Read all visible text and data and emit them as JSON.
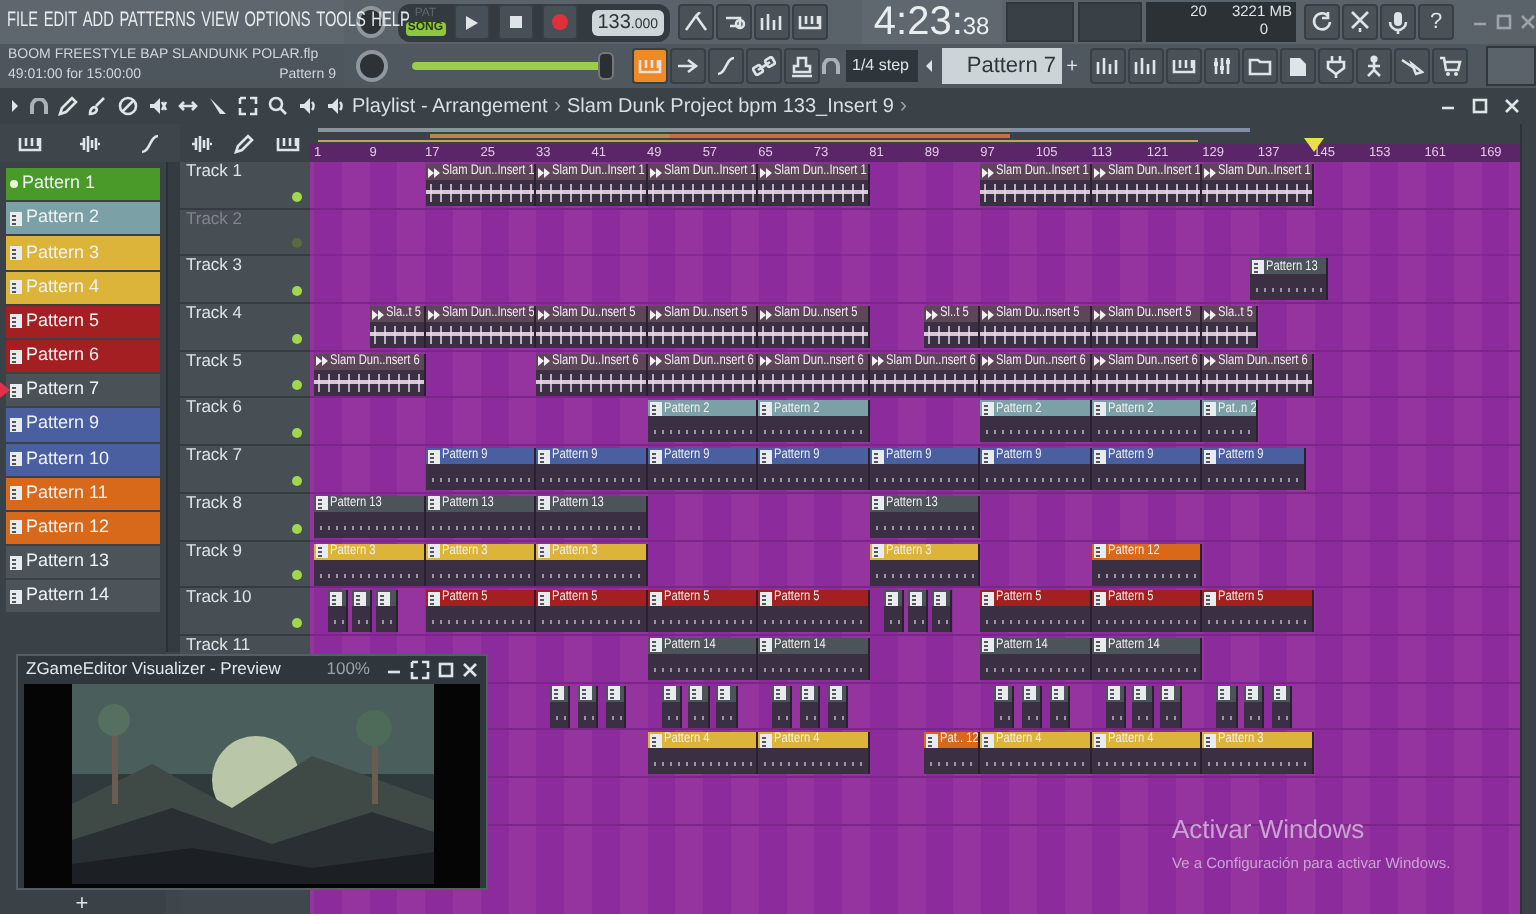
{
  "menu": [
    "FILE",
    "EDIT",
    "ADD",
    "PATTERNS",
    "VIEW",
    "OPTIONS",
    "TOOLS",
    "HELP"
  ],
  "mode_toggle": [
    {
      "label": "PAT",
      "selected": false
    },
    {
      "label": "SONG",
      "selected": true
    }
  ],
  "tempo": {
    "whole": "133",
    "fraction": ".000"
  },
  "time": {
    "main": "4:23:",
    "small": "38"
  },
  "cpu": {
    "value": "20",
    "memory": "3221 MB",
    "polyphony": "0"
  },
  "help_button": "?",
  "info": {
    "file": "BOOM FREESTYLE BAP SLANDUNK POLAR.flp",
    "position": "49:01:00 for 15:00:00",
    "pattern": "Pattern 9"
  },
  "pitch_slider": {
    "level": 0.97
  },
  "keyboard_toggle": {
    "on": true
  },
  "snap": "1/4 step",
  "pattern_selector": {
    "value": "Pattern 7",
    "add": "+"
  },
  "breadcrumb": [
    {
      "kind": "crumb",
      "text": "Playlist - Arrangement"
    },
    {
      "kind": "sep",
      "text": "›"
    },
    {
      "kind": "crumb",
      "text": "Slam Dunk Project bpm 133_Insert 9"
    },
    {
      "kind": "sep",
      "text": "›"
    }
  ],
  "ruler": [
    "1",
    "9",
    "17",
    "25",
    "33",
    "41",
    "49",
    "57",
    "65",
    "73",
    "81",
    "89",
    "97",
    "105",
    "113",
    "121",
    "129",
    "137",
    "145",
    "153",
    "161",
    "169"
  ],
  "patterns": [
    {
      "label": "Pattern 1",
      "color": "#4a9a2a",
      "selected": true,
      "current": false
    },
    {
      "label": "Pattern 2",
      "color": "#7ba1a6",
      "selected": false,
      "current": false
    },
    {
      "label": "Pattern 3",
      "color": "#dcb43a",
      "selected": false,
      "current": false
    },
    {
      "label": "Pattern 4",
      "color": "#dcb43a",
      "selected": false,
      "current": false
    },
    {
      "label": "Pattern 5",
      "color": "#a31f22",
      "selected": false,
      "current": false
    },
    {
      "label": "Pattern 6",
      "color": "#a31f22",
      "selected": false,
      "current": false
    },
    {
      "label": "Pattern 7",
      "color": "#4a5157",
      "selected": false,
      "current": true
    },
    {
      "label": "Pattern 9",
      "color": "#4a5fa0",
      "selected": false,
      "current": false
    },
    {
      "label": "Pattern 10",
      "color": "#4a5fa0",
      "selected": false,
      "current": false
    },
    {
      "label": "Pattern 11",
      "color": "#d8691a",
      "selected": false,
      "current": false
    },
    {
      "label": "Pattern 12",
      "color": "#d8691a",
      "selected": false,
      "current": false
    },
    {
      "label": "Pattern 13",
      "color": "#4d5459",
      "selected": false,
      "current": false
    },
    {
      "label": "Pattern 14",
      "color": "#4d5459",
      "selected": false,
      "current": false
    }
  ],
  "tracks": [
    {
      "name": "Track 1",
      "muted": false,
      "clips": [
        {
          "kind": "audio",
          "label": "Slam Dun..Insert 1",
          "color": "#5c4658"
        },
        {
          "kind": "audio",
          "label": "Slam Dun..Insert 1",
          "color": "#5c4658"
        },
        {
          "kind": "audio",
          "label": "Slam Dun..Insert 1",
          "color": "#5c4658"
        },
        {
          "kind": "audio",
          "label": "Slam Dun..Insert 1",
          "color": "#5c4658"
        },
        {
          "kind": "audio",
          "label": "Slam Dun..Insert 1",
          "color": "#5c4658"
        },
        {
          "kind": "audio",
          "label": "Slam Dun..Insert 1",
          "color": "#5c4658"
        },
        {
          "kind": "audio",
          "label": "Slam Dun..Insert 1",
          "color": "#5c4658"
        }
      ]
    },
    {
      "name": "Track 2",
      "muted": true
    },
    {
      "name": "Track 3",
      "muted": false,
      "clips": [
        {
          "kind": "pattern",
          "label": "Pattern 13",
          "color": "#4d5459"
        }
      ]
    },
    {
      "name": "Track 4",
      "muted": false,
      "clips": [
        {
          "kind": "audio",
          "label": "Sla..t 5",
          "color": "#5c4658"
        },
        {
          "kind": "audio",
          "label": "Slam Dun..Insert 5",
          "color": "#5c4658"
        },
        {
          "kind": "audio",
          "label": "Slam Du..nsert 5",
          "color": "#5c4658"
        },
        {
          "kind": "audio",
          "label": "Slam Du..nsert 5",
          "color": "#5c4658"
        },
        {
          "kind": "audio",
          "label": "Slam Du..nsert 5",
          "color": "#5c4658"
        },
        {
          "kind": "audio",
          "label": "Sl..t 5",
          "color": "#5c4658"
        },
        {
          "kind": "audio",
          "label": "Slam Du..nsert 5",
          "color": "#5c4658"
        },
        {
          "kind": "audio",
          "label": "Slam Du..nsert 5",
          "color": "#5c4658"
        },
        {
          "kind": "audio",
          "label": "Sla..t 5",
          "color": "#5c4658"
        }
      ]
    },
    {
      "name": "Track 5",
      "muted": false,
      "clips": [
        {
          "kind": "audio",
          "label": "Slam Dun..nsert 6",
          "color": "#5c4658"
        },
        {
          "kind": "audio",
          "label": "Slam Du..Insert 6",
          "color": "#5c4658"
        },
        {
          "kind": "audio",
          "label": "Slam Dun..nsert 6",
          "color": "#5c4658"
        },
        {
          "kind": "audio",
          "label": "Slam Dun..nsert 6",
          "color": "#5c4658"
        },
        {
          "kind": "audio",
          "label": "Slam Dun..nsert 6",
          "color": "#5c4658"
        },
        {
          "kind": "audio",
          "label": "Slam Dun..nsert 6",
          "color": "#5c4658"
        },
        {
          "kind": "audio",
          "label": "Slam Dun..nsert 6",
          "color": "#5c4658"
        },
        {
          "kind": "audio",
          "label": "Slam Dun..nsert 6",
          "color": "#5c4658"
        }
      ]
    },
    {
      "name": "Track 6",
      "muted": false,
      "clips": [
        {
          "kind": "pattern",
          "label": "Pattern 2",
          "color": "#7ba1a6"
        },
        {
          "kind": "pattern",
          "label": "Pattern 2",
          "color": "#7ba1a6"
        },
        {
          "kind": "pattern",
          "label": "Pattern 2",
          "color": "#7ba1a6"
        },
        {
          "kind": "pattern",
          "label": "Pattern 2",
          "color": "#7ba1a6"
        },
        {
          "kind": "pattern",
          "label": "Pat..n 2",
          "color": "#7ba1a6"
        }
      ]
    },
    {
      "name": "Track 7",
      "muted": false,
      "clips": [
        {
          "kind": "pattern",
          "label": "Pattern 9",
          "color": "#4a5fa0"
        },
        {
          "kind": "pattern",
          "label": "Pattern 9",
          "color": "#4a5fa0"
        },
        {
          "kind": "pattern",
          "label": "Pattern 9",
          "color": "#4a5fa0"
        },
        {
          "kind": "pattern",
          "label": "Pattern 9",
          "color": "#4a5fa0"
        },
        {
          "kind": "pattern",
          "label": "Pattern 9",
          "color": "#4a5fa0"
        },
        {
          "kind": "pattern",
          "label": "Pattern 9",
          "color": "#4a5fa0"
        },
        {
          "kind": "pattern",
          "label": "Pattern 9",
          "color": "#4a5fa0"
        },
        {
          "kind": "pattern",
          "label": "Pattern 9",
          "color": "#4a5fa0"
        }
      ]
    },
    {
      "name": "Track 8",
      "muted": false,
      "clips": [
        {
          "kind": "pattern",
          "label": "Pattern 13",
          "color": "#4d5459"
        },
        {
          "kind": "pattern",
          "label": "Pattern 13",
          "color": "#4d5459"
        },
        {
          "kind": "pattern",
          "label": "Pattern 13",
          "color": "#4d5459"
        },
        {
          "kind": "pattern",
          "label": "Pattern 13",
          "color": "#4d5459"
        }
      ]
    },
    {
      "name": "Track 9",
      "muted": false,
      "clips": [
        {
          "kind": "pattern",
          "label": "Pattern 3",
          "color": "#dcb43a"
        },
        {
          "kind": "pattern",
          "label": "Pattern 3",
          "color": "#dcb43a"
        },
        {
          "kind": "pattern",
          "label": "Pattern 3",
          "color": "#dcb43a"
        },
        {
          "kind": "pattern",
          "label": "Pattern 3",
          "color": "#dcb43a"
        },
        {
          "kind": "pattern",
          "label": "Pattern 12",
          "color": "#d8691a"
        }
      ]
    },
    {
      "name": "Track 10",
      "muted": false,
      "clips": [
        {
          "kind": "pattern",
          "color": "#4d5459"
        },
        {
          "kind": "pattern",
          "color": "#4d5459"
        },
        {
          "kind": "pattern",
          "color": "#4d5459"
        },
        {
          "kind": "pattern",
          "label": "Pattern 5",
          "color": "#a31f22"
        },
        {
          "kind": "pattern",
          "label": "Pattern 5",
          "color": "#a31f22"
        },
        {
          "kind": "pattern",
          "label": "Pattern 5",
          "color": "#a31f22"
        },
        {
          "kind": "pattern",
          "label": "Pattern 5",
          "color": "#a31f22"
        },
        {
          "kind": "pattern",
          "color": "#4d5459"
        },
        {
          "kind": "pattern",
          "color": "#4d5459"
        },
        {
          "kind": "pattern",
          "color": "#4d5459"
        },
        {
          "kind": "pattern",
          "label": "Pattern 5",
          "color": "#a31f22"
        },
        {
          "kind": "pattern",
          "label": "Pattern 5",
          "color": "#a31f22"
        },
        {
          "kind": "pattern",
          "label": "Pattern 5",
          "color": "#a31f22"
        }
      ]
    },
    {
      "name": "Track 11",
      "muted": false,
      "clips": [
        {
          "kind": "pattern",
          "label": "Pattern 14",
          "color": "#4d5459"
        },
        {
          "kind": "pattern",
          "label": "Pattern 14",
          "color": "#4d5459"
        },
        {
          "kind": "pattern",
          "label": "Pattern 14",
          "color": "#4d5459"
        },
        {
          "kind": "pattern",
          "label": "Pattern 14",
          "color": "#4d5459"
        }
      ]
    },
    {
      "clips": [
        {
          "kind": "pattern",
          "color": "#4d5459"
        },
        {
          "kind": "pattern",
          "color": "#4d5459"
        },
        {
          "kind": "pattern",
          "color": "#4d5459"
        },
        {
          "kind": "pattern",
          "color": "#4d5459"
        },
        {
          "kind": "pattern",
          "color": "#4d5459"
        },
        {
          "kind": "pattern",
          "color": "#4d5459"
        },
        {
          "kind": "pattern",
          "color": "#4d5459"
        },
        {
          "kind": "pattern",
          "color": "#4d5459"
        },
        {
          "kind": "pattern",
          "color": "#4d5459"
        },
        {
          "kind": "pattern",
          "color": "#4d5459"
        },
        {
          "kind": "pattern",
          "color": "#4d5459"
        },
        {
          "kind": "pattern",
          "color": "#4d5459"
        },
        {
          "kind": "pattern",
          "color": "#4d5459"
        },
        {
          "kind": "pattern",
          "color": "#4d5459"
        },
        {
          "kind": "pattern",
          "color": "#4d5459"
        },
        {
          "kind": "pattern",
          "color": "#4d5459"
        },
        {
          "kind": "pattern",
          "color": "#4d5459"
        },
        {
          "kind": "pattern",
          "color": "#4d5459"
        }
      ]
    },
    {
      "clips": [
        {
          "kind": "pattern",
          "label": "Pattern 4",
          "color": "#dcb43a"
        },
        {
          "kind": "pattern",
          "label": "Pattern 4",
          "color": "#dcb43a"
        },
        {
          "kind": "pattern",
          "label": "Pat.. 12",
          "color": "#d8691a"
        },
        {
          "kind": "pattern",
          "label": "Pattern 4",
          "color": "#dcb43a"
        },
        {
          "kind": "pattern",
          "label": "Pattern 4",
          "color": "#dcb43a"
        },
        {
          "kind": "pattern",
          "label": "Pattern 3",
          "color": "#dcb43a"
        }
      ]
    }
  ],
  "preview": {
    "title": "ZGameEditor Visualizer - Preview",
    "zoom": "100%"
  },
  "add_button": "+",
  "activation": {
    "title": "Activar Windows",
    "text": "Ve a Configuración para activar Windows."
  }
}
